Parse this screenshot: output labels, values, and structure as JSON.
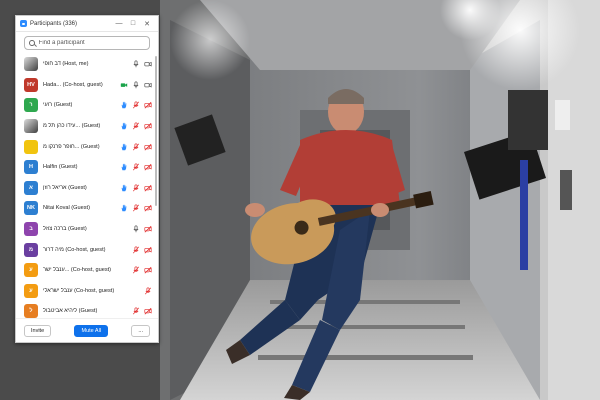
{
  "panel": {
    "title": "Participants (336)",
    "search_placeholder": "Find a participant",
    "participants": [
      {
        "name": "דב חופי (Host, me)",
        "initials": "",
        "avatar_color": "",
        "photo": true,
        "hand": false,
        "video": "camera",
        "mic": "on"
      },
      {
        "name": "Hada... (Co-host, guest)",
        "initials": "HV",
        "avatar_color": "#c0392b",
        "photo": false,
        "hand": false,
        "video": "camera-green",
        "mic": "on"
      },
      {
        "name": "רועי (Guest)",
        "initials": "ר",
        "avatar_color": "#2fa84f",
        "photo": false,
        "hand": true,
        "video": "camera-off",
        "mic": "muted"
      },
      {
        "name": "עידו כהן תל מ... (Guest)",
        "initials": "",
        "avatar_color": "",
        "photo": true,
        "hand": true,
        "video": "camera-off",
        "mic": "muted"
      },
      {
        "name": "חופר פרנקו מ... (Guest)",
        "initials": "",
        "avatar_color": "#f1c40f",
        "photo": true,
        "hand": true,
        "video": "camera-off",
        "mic": "muted"
      },
      {
        "name": "Halfin (Guest)",
        "initials": "H",
        "avatar_color": "#2d7fd1",
        "photo": false,
        "hand": true,
        "video": "camera-off",
        "mic": "muted"
      },
      {
        "name": "אריאל רוזן (Guest)",
        "initials": "א",
        "avatar_color": "#2d7fd1",
        "photo": false,
        "hand": true,
        "video": "camera-off",
        "mic": "muted"
      },
      {
        "name": "Nitai Koval (Guest)",
        "initials": "NK",
        "avatar_color": "#2d7fd1",
        "photo": false,
        "hand": true,
        "video": "camera-off",
        "mic": "muted"
      },
      {
        "name": "ברכה צוזל (Guest)",
        "initials": "ב",
        "avatar_color": "#8e44ad",
        "photo": false,
        "hand": false,
        "video": "camera-off",
        "mic": "on"
      },
      {
        "name": "מיה דרור (Co-host, guest)",
        "initials": "מ",
        "avatar_color": "#6a3fa0",
        "photo": false,
        "hand": false,
        "video": "camera-off",
        "mic": "muted"
      },
      {
        "name": "ענבל ישר... (Co-host, guest)",
        "initials": "ע",
        "avatar_color": "#f39c12",
        "photo": false,
        "hand": false,
        "video": "camera-off",
        "mic": "muted"
      },
      {
        "name": "ענבל ישראלי (Co-host, guest)",
        "initials": "ע",
        "avatar_color": "#f39c12",
        "photo": false,
        "hand": false,
        "video": "none",
        "mic": "muted"
      },
      {
        "name": "ליהיא אביטבול (Guest)",
        "initials": "ל",
        "avatar_color": "#e67e22",
        "photo": false,
        "hand": false,
        "video": "camera-off",
        "mic": "muted"
      }
    ],
    "footer": {
      "invite_label": "Invite",
      "mute_all_label": "Mute All",
      "more_label": "..."
    }
  },
  "colors": {
    "accent": "#0e71eb",
    "muted_red": "#e02828",
    "hand": "#2d8cff"
  }
}
